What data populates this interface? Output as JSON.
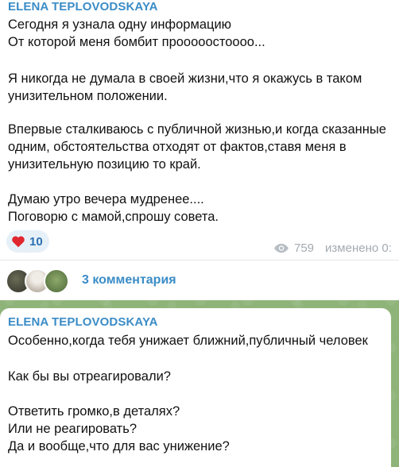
{
  "post1": {
    "author": "ELENA TEPLOVODSKAYA",
    "lines": [
      "Сегодня я узнала одну информацию",
      "От которой меня бомбит прооооостоооо...",
      "",
      "Я никогда не думала в своей жизни,что я окажусь в таком",
      "унизительном положении.",
      "",
      "Впервые сталкиваюсь с публичной жизнью,и когда сказанные",
      "одним, обстоятельства отходят от фактов,ставя меня в",
      "унизительную позицию то край.",
      "",
      "Думаю утро вечера мудренее....",
      "Поговорю с мамой,спрошу совета."
    ],
    "reaction": {
      "icon": "heart-icon",
      "count": "10"
    },
    "views": "759",
    "edited": "изменено 0:",
    "comments_label": "3 комментария"
  },
  "post2": {
    "author": "ELENA TEPLOVODSKAYA",
    "lines": [
      "Особенно,когда тебя унижает ближний,публичный человек",
      "",
      "Как бы вы отреагировали?",
      "",
      "Ответить громко,в деталях?",
      "Или не реагировать?",
      "Да и вообще,что для вас унижение?"
    ]
  },
  "colors": {
    "accent": "#3a8cc6",
    "background": "#8fb47a",
    "heart": "#e0262f"
  }
}
